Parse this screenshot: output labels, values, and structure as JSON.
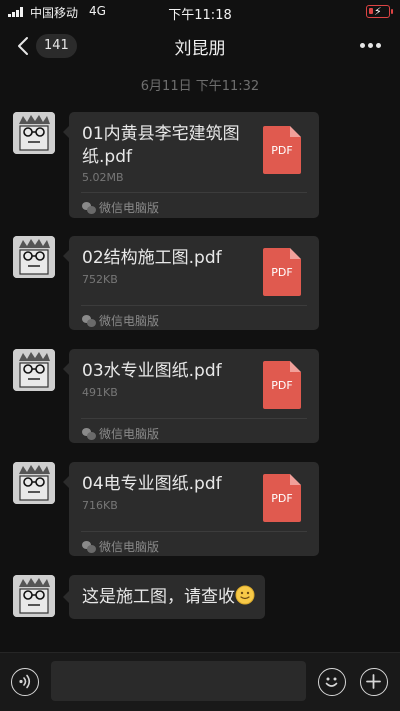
{
  "status_bar": {
    "carrier": "中国移动",
    "network": "4G",
    "time": "下午11:18",
    "battery_color": "#dd4444"
  },
  "nav": {
    "back_icon": "chevron-left-icon",
    "unread_count": "141",
    "title": "刘昆朋",
    "more_icon": "ellipsis-icon"
  },
  "chat": {
    "timestamp": "6月11日 下午11:32",
    "messages": [
      {
        "type": "file",
        "file_name": "01内黄县李宅建筑图纸.pdf",
        "file_size": "5.02MB",
        "file_type": "PDF",
        "source": "微信电脑版"
      },
      {
        "type": "file",
        "file_name": "02结构施工图.pdf",
        "file_size": "752KB",
        "file_type": "PDF",
        "source": "微信电脑版"
      },
      {
        "type": "file",
        "file_name": "03水专业图纸.pdf",
        "file_size": "491KB",
        "file_type": "PDF",
        "source": "微信电脑版"
      },
      {
        "type": "file",
        "file_name": "04电专业图纸.pdf",
        "file_size": "716KB",
        "file_type": "PDF",
        "source": "微信电脑版"
      },
      {
        "type": "text",
        "text": "这是施工图，请查收",
        "emoji": "smile-emoji-icon"
      }
    ]
  },
  "input_bar": {
    "voice_icon": "voice-icon",
    "emoji_icon": "smile-icon",
    "plus_icon": "plus-icon",
    "input_value": ""
  },
  "colors": {
    "background": "#111111",
    "bubble": "#2c2c2c",
    "pdf_red": "#e05a4f"
  }
}
